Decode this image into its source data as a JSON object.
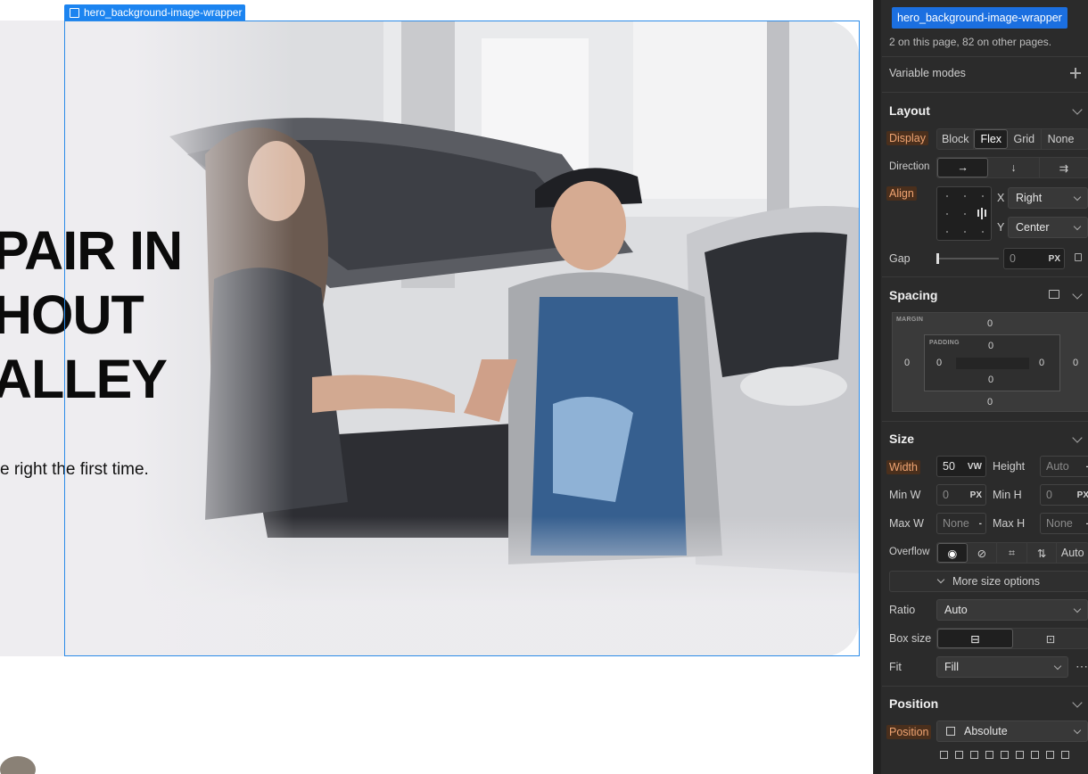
{
  "canvas": {
    "selected_tag": "hero_background-image-wrapper",
    "hero_heading": "PAIR IN\nHOUT\nALLEY",
    "hero_sub": "e right the first time."
  },
  "panel": {
    "class_chip": "hero_background-image-wrapper",
    "usage": "2 on this page, 82 on other pages.",
    "variable_modes": "Variable modes",
    "layout": {
      "title": "Layout",
      "display_label": "Display",
      "display_options": [
        "Block",
        "Flex",
        "Grid",
        "None"
      ],
      "display_selected": "Flex",
      "direction_label": "Direction",
      "align_label": "Align",
      "x_label": "X",
      "x_value": "Right",
      "y_label": "Y",
      "y_value": "Center",
      "gap_label": "Gap",
      "gap_value": "0",
      "gap_unit": "PX"
    },
    "spacing": {
      "title": "Spacing",
      "margin_label": "MARGIN",
      "padding_label": "PADDING",
      "margin_top": "0",
      "margin_right": "0",
      "margin_bottom": "0",
      "margin_left": "0",
      "padding_top": "0",
      "padding_right": "0",
      "padding_bottom": "0",
      "padding_left": "0"
    },
    "size": {
      "title": "Size",
      "width_label": "Width",
      "width_value": "50",
      "width_unit": "VW",
      "height_label": "Height",
      "height_value": "Auto",
      "min_w_label": "Min W",
      "min_w_value": "0",
      "min_w_unit": "PX",
      "min_h_label": "Min H",
      "min_h_value": "0",
      "min_h_unit": "PX",
      "max_w_label": "Max W",
      "max_w_value": "None",
      "max_h_label": "Max H",
      "max_h_value": "None",
      "overflow_label": "Overflow",
      "overflow_auto": "Auto",
      "more_options": "More size options",
      "ratio_label": "Ratio",
      "ratio_value": "Auto",
      "box_size_label": "Box size",
      "fit_label": "Fit",
      "fit_value": "Fill"
    },
    "position": {
      "title": "Position",
      "position_label": "Position",
      "position_value": "Absolute"
    }
  },
  "colors": {
    "accent": "#1c84f0",
    "panel_bg": "#2b2b2b",
    "set_property": "#f0a472"
  }
}
